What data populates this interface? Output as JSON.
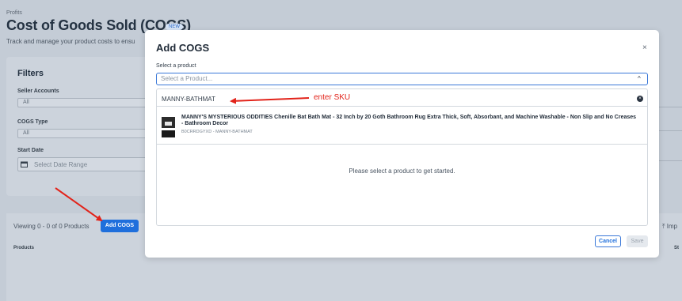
{
  "page": {
    "breadcrumb": "Profits",
    "title": "Cost of Goods Sold (COGS)",
    "badge": "NEW",
    "subtitle": "Track and manage your product costs to ensu"
  },
  "filters": {
    "title": "Filters",
    "seller_accounts_label": "Seller Accounts",
    "seller_accounts_value": "All",
    "cogs_type_label": "COGS Type",
    "cogs_type_value": "All",
    "start_date_label": "Start Date",
    "start_date_placeholder": "Select Date Range"
  },
  "list": {
    "viewing_text": "Viewing 0 - 0 of 0 Products",
    "add_button_label": "Add COGS",
    "import_label": "Imp",
    "col_products": "Products",
    "col_status": "St"
  },
  "modal": {
    "title": "Add COGS",
    "close_glyph": "×",
    "select_label": "Select a product",
    "select_placeholder": "Select a Product...",
    "chevron_glyph": "^",
    "search_value": "MANNY-BATHMAT",
    "annotation_text": "enter SKU",
    "result": {
      "title": "MANNY'S MYSTERIOUS ODDITIES Chenille Bat Bath Mat - 32 Inch by 20 Goth Bathroom Rug Extra Thick, Soft, Absorbant, and Machine Washable - Non Slip and No Creases - Bathroom Decor",
      "asin": "B0CRRDGYXD",
      "separator": "-",
      "sku": "MANNY-BATHMAT"
    },
    "empty_message": "Please select a product to get started.",
    "cancel_label": "Cancel",
    "save_label": "Save"
  },
  "colors": {
    "accent": "#1f6fdc",
    "annotation": "#e2231a",
    "overlay": "#c4ccd6"
  },
  "icons": {
    "clear": "clear-icon",
    "calendar": "calendar-icon",
    "chevron": "chevron-up-icon",
    "close": "close-icon"
  }
}
